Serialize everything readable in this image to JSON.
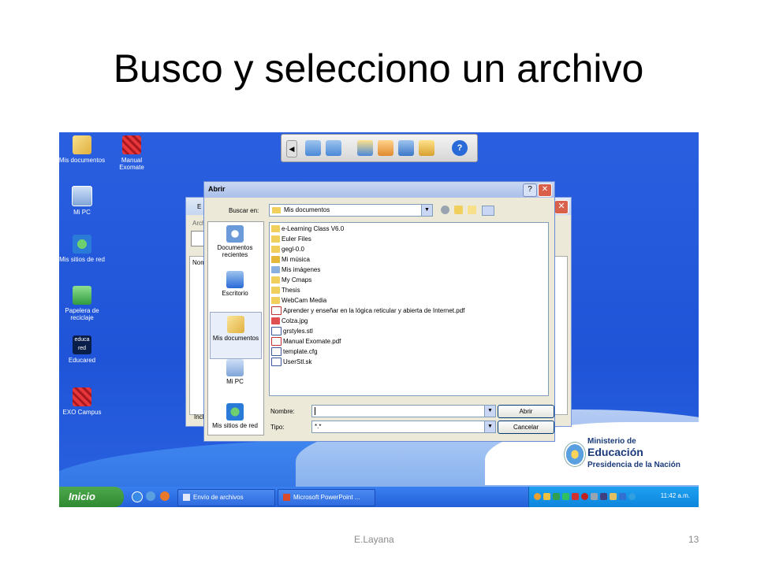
{
  "slide": {
    "title": "Busco y selecciono un archivo",
    "footer_author": "E.Layana",
    "page_number": "13"
  },
  "desktop": {
    "icons": [
      {
        "label": "Mis documentos",
        "icon": "my-documents-icon"
      },
      {
        "label": "Manual Exomate",
        "icon": "exomate-icon"
      },
      {
        "label": "Mi PC",
        "icon": "my-computer-icon"
      },
      {
        "label": "Mis sitios de red",
        "icon": "network-places-icon"
      },
      {
        "label": "Papelera de reciclaje",
        "icon": "recycle-bin-icon"
      },
      {
        "label": "Educared",
        "icon": "educared-icon"
      },
      {
        "label": "EXO Campus",
        "icon": "exo-campus-icon"
      }
    ],
    "educared_logo": "educa red"
  },
  "background_window": {
    "title_fragment": "E",
    "menu_fragment": "Arch",
    "column_fragment": "Nom",
    "status_fragment": "Incl"
  },
  "dialog": {
    "title": "Abrir",
    "look_in_label": "Buscar en:",
    "look_in_value": "Mis documentos",
    "places": [
      {
        "label": "Documentos recientes",
        "icon": "recent-documents-icon"
      },
      {
        "label": "Escritorio",
        "icon": "desktop-icon"
      },
      {
        "label": "Mis documentos",
        "icon": "my-documents-icon"
      },
      {
        "label": "Mi PC",
        "icon": "my-computer-icon"
      },
      {
        "label": "Mis sitios de red",
        "icon": "network-places-icon"
      }
    ],
    "files": [
      {
        "name": "e-Learning Class V6.0",
        "type": "folder"
      },
      {
        "name": "Euler Files",
        "type": "folder"
      },
      {
        "name": "gegl-0.0",
        "type": "folder"
      },
      {
        "name": "Mi música",
        "type": "music-folder"
      },
      {
        "name": "Mis imágenes",
        "type": "pictures-folder"
      },
      {
        "name": "My Cmaps",
        "type": "folder"
      },
      {
        "name": "Thesis",
        "type": "folder"
      },
      {
        "name": "WebCam Media",
        "type": "folder"
      },
      {
        "name": "Aprender y enseñar en la lógica reticular y abierta de Internet.pdf",
        "type": "pdf"
      },
      {
        "name": "Colza.jpg",
        "type": "image"
      },
      {
        "name": "grstyles.stl",
        "type": "file"
      },
      {
        "name": "Manual Exomate.pdf",
        "type": "pdf"
      },
      {
        "name": "template.cfg",
        "type": "file"
      },
      {
        "name": "UserStl.sk",
        "type": "file"
      }
    ],
    "filename_label": "Nombre:",
    "filename_value": "",
    "filetype_label": "Tipo:",
    "filetype_value": "*.*",
    "open_button": "Abrir",
    "cancel_button": "Cancelar",
    "help_button": "?",
    "close_button": "✕"
  },
  "taskbar": {
    "start_label": "Inicio",
    "tasks": [
      {
        "label": "Envío de archivos"
      },
      {
        "label": "Microsoft PowerPoint ..."
      }
    ],
    "clock": "11:42 a.m."
  },
  "branding": {
    "line1": "Ministerio de",
    "line2": "Educación",
    "line3": "Presidencia de la Nación"
  },
  "colors": {
    "desktop_blue": "#1f54d8",
    "title_bar": "#aac0ea",
    "close_red": "#d9604a",
    "start_green": "#3a963a",
    "folder_yellow": "#f1cf5c"
  }
}
